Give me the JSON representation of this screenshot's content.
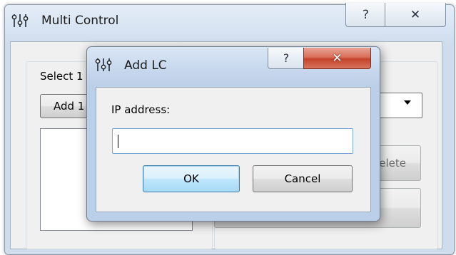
{
  "main_window": {
    "title": "Multi Control",
    "help_glyph": "?",
    "close_glyph": "✕",
    "select_label": "Select 1",
    "add_button_label": "Add 1",
    "delete_button_label": "elete"
  },
  "dialog": {
    "title": "Add LC",
    "help_glyph": "?",
    "close_glyph": "✕",
    "ip_label": "IP address:",
    "ip_value": "",
    "ok_label": "OK",
    "cancel_label": "Cancel"
  },
  "icons": {
    "app": "sliders-icon",
    "help": "question-mark-icon",
    "close": "close-icon",
    "dropdown": "chevron-down-icon"
  },
  "colors": {
    "close_button_red": "#c4432b",
    "ok_button_blue": "#bee6fd",
    "title_bar": "#d5e2f1",
    "client_area": "#f0f0f0"
  }
}
